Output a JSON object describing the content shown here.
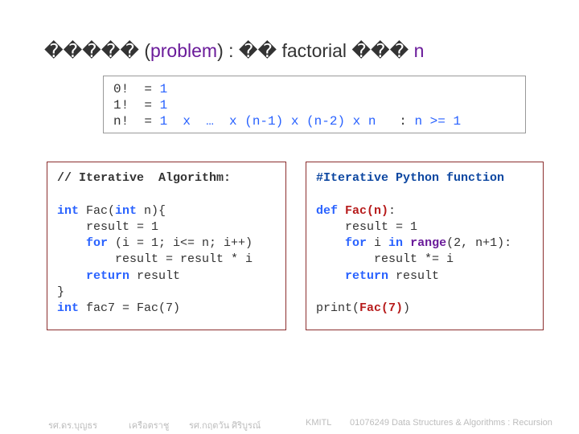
{
  "title": {
    "prefix": "����� ",
    "paren_open": "(",
    "problem_word": "problem",
    "paren_close": ")",
    "mid": " :  �� factorial ��� ",
    "n": "n"
  },
  "defbox": {
    "l1_a": "0!  = ",
    "l1_b": "1",
    "l2_a": "1!  = ",
    "l2_b": "1",
    "l3_a": "n!  = ",
    "l3_b": "1  x  …  x (n-1) x (n-2) x n",
    "l3_c": "   : ",
    "l3_d": "n >= 1"
  },
  "left": {
    "h1": "// Iterative  Algorithm:",
    "blank1": "",
    "l1a": "int",
    "l1b": " Fac(",
    "l1c": "int",
    "l1d": " n){",
    "l2": "    result = 1",
    "l3a": "    ",
    "l3b": "for",
    "l3c": " (i = 1; i<= n; i++)",
    "l4": "        result = result * i",
    "l5a": "    ",
    "l5b": "return",
    "l5c": " result",
    "l6": "}",
    "l7a": "int",
    "l7b": " fac7 = Fac(7)"
  },
  "right": {
    "h1": "#Iterative Python function",
    "blank1": "",
    "l1a": "def ",
    "l1b": "Fac(n)",
    "l1c": ":",
    "l2": "    result = 1",
    "l3a": "    ",
    "l3b": "for",
    "l3c": " i ",
    "l3d": "in",
    "l3e": " ",
    "l3f": "range",
    "l3g": "(2, n+1):",
    "l4": "        result *= i",
    "l5a": "    ",
    "l5b": "return",
    "l5c": " result",
    "blank2": "",
    "l6a": "print(",
    "l6b": "Fac(7)",
    "l6c": ")"
  },
  "footer": {
    "f1": "รศ.ดร.บุญธร",
    "f2": "เครือตราชู",
    "f3": "รศ.กฤตวัน  ศิริบูรณ์",
    "f4": "KMITL",
    "f5": "01076249 Data Structures & Algorithms : Recursion"
  }
}
